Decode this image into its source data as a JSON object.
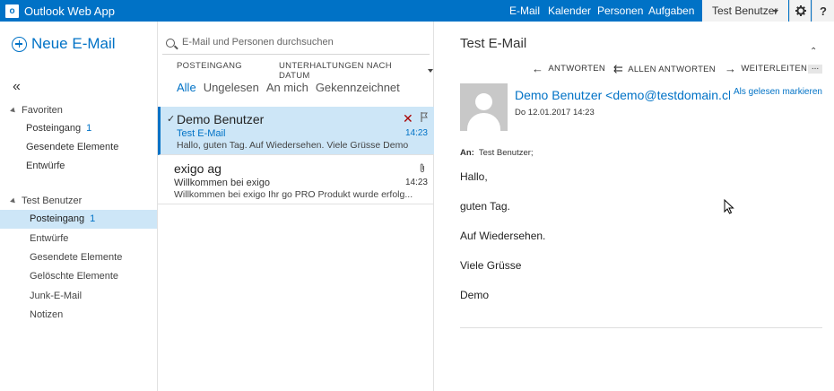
{
  "app": {
    "logo_letter": "o",
    "title": "Outlook Web App"
  },
  "nav": {
    "mail": "E-Mail",
    "calendar": "Kalender",
    "people": "Personen",
    "tasks": "Aufgaben",
    "user": "Test Benutzer",
    "help": "?"
  },
  "left": {
    "new_mail": "Neue E-Mail",
    "collapse": "«",
    "favorites_title": "Favoriten",
    "favorites": [
      {
        "label": "Posteingang",
        "count": "1"
      },
      {
        "label": "Gesendete Elemente",
        "count": ""
      },
      {
        "label": "Entwürfe",
        "count": ""
      }
    ],
    "account_title": "Test Benutzer",
    "folders": [
      {
        "label": "Posteingang",
        "count": "1"
      },
      {
        "label": "Entwürfe",
        "count": ""
      },
      {
        "label": "Gesendete Elemente",
        "count": ""
      },
      {
        "label": "Gelöschte Elemente",
        "count": ""
      },
      {
        "label": "Junk-E-Mail",
        "count": ""
      },
      {
        "label": "Notizen",
        "count": ""
      }
    ]
  },
  "list": {
    "search_placeholder": "E-Mail und Personen durchsuchen",
    "header": "POSTEINGANG",
    "sort": "UNTERHALTUNGEN NACH DATUM",
    "filters": [
      "Alle",
      "Ungelesen",
      "An mich",
      "Gekennzeichnet"
    ],
    "messages": [
      {
        "sender": "Demo Benutzer",
        "subject": "Test E-Mail",
        "preview": "Hallo,  guten Tag.  Auf Wiedersehen.  Viele Grüsse  Demo",
        "time": "14:23",
        "check": "✓",
        "delete": "✕"
      },
      {
        "sender": "exigo ag",
        "subject": "Willkommen bei exigo",
        "preview": "Willkommen bei exigo  Ihr go PRO Produkt wurde erfolg...",
        "time": "14:23"
      }
    ]
  },
  "reading": {
    "subject": "Test E-Mail",
    "collapse": "⌃",
    "reply": "ANTWORTEN",
    "reply_all": "ALLEN ANTWORTEN",
    "forward": "WEITERLEITEN",
    "more": "...",
    "from": "Demo Benutzer <demo@testdomain.ch>",
    "mark_read": "Als gelesen markieren",
    "date": "Do 12.01.2017 14:23",
    "to_label": "An:",
    "to_value": "Test Benutzer;",
    "body": [
      "Hallo,",
      "guten Tag.",
      "Auf Wiedersehen.",
      "Viele Grüsse",
      "Demo"
    ]
  },
  "colors": {
    "brand": "#0072c6",
    "selection": "#cde6f7",
    "delete": "#a80000"
  }
}
